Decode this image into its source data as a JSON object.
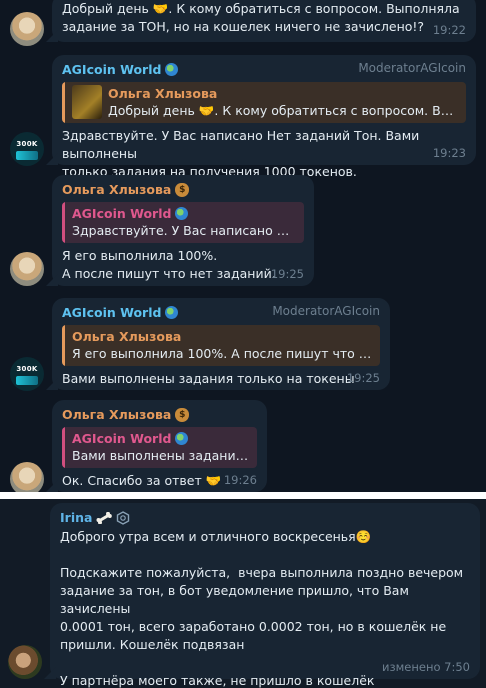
{
  "messages": {
    "m1": {
      "text": "Добрый день 🤝. К кому обратиться с вопросом. Выполняла\nзадание за ТОН, но на кошелек ничего не зачислено!?",
      "time": "19:22"
    },
    "m2": {
      "sender": "AGIcoin World",
      "role": "ModeratorAGIcoin",
      "reply_name": "Ольга Хлызова",
      "reply_text": "Добрый день 🤝. К кому обратиться с вопросом. Выполняла",
      "text": "Здравствуйте. У Вас написано Нет заданий Тон. Вами выполнены\nтолько задания на получения 1000 токенов.",
      "time": "19:23"
    },
    "m3": {
      "sender": "Ольга Хлызова",
      "reply_name": "AGIcoin World",
      "reply_text": "Здравствуйте. У Вас написано Нет заданий Тон.",
      "text": "Я его выполнила 100%.\nА после пишут что нет заданий.",
      "time": "19:25"
    },
    "m4": {
      "sender": "AGIcoin World",
      "role": "ModeratorAGIcoin",
      "reply_name": "Ольга Хлызова",
      "reply_text": "Я его выполнила 100%.  А после пишут что нет заданий.",
      "text": "Вами выполнены задания только на токены",
      "time": "19:25"
    },
    "m5": {
      "sender": "Ольга Хлызова",
      "reply_name": "AGIcoin World",
      "reply_text": "Вами выполнены задания только на токены",
      "text": "Ок. Спасибо за ответ 🤝",
      "time": "19:26"
    },
    "m6": {
      "sender": "Irina",
      "text": "Доброго утра всем и отличного воскресенья☺️\n\nПодскажите пожалуйста,  вчера выполнила поздно вечером\nзадание за тон, в бот уведомление пришло, что Вам зачислены\n0.0001 тон, всего заработано 0.0002 тон, но в кошелёк не\nпришли. Кошелёк подвязан\n\nУ партнёра моего также, не пришло в кошелёк",
      "time": "изменено 7:50"
    }
  },
  "avatars": {
    "agi_label": "300K"
  },
  "colors": {
    "background": "#0e1621",
    "bubble": "#182533",
    "agi_name": "#5ec2f0",
    "olga_name": "#e59a5c",
    "irina_name": "#5fb4e7",
    "meta": "#6d7f8f"
  },
  "icons": {
    "globe": "globe-emoji-icon",
    "money_bag": "money-bag-emoji-icon",
    "handshake": "handshake-emoji-icon",
    "bone": "bone-emoji-icon",
    "badge": "custom-badge-icon"
  }
}
